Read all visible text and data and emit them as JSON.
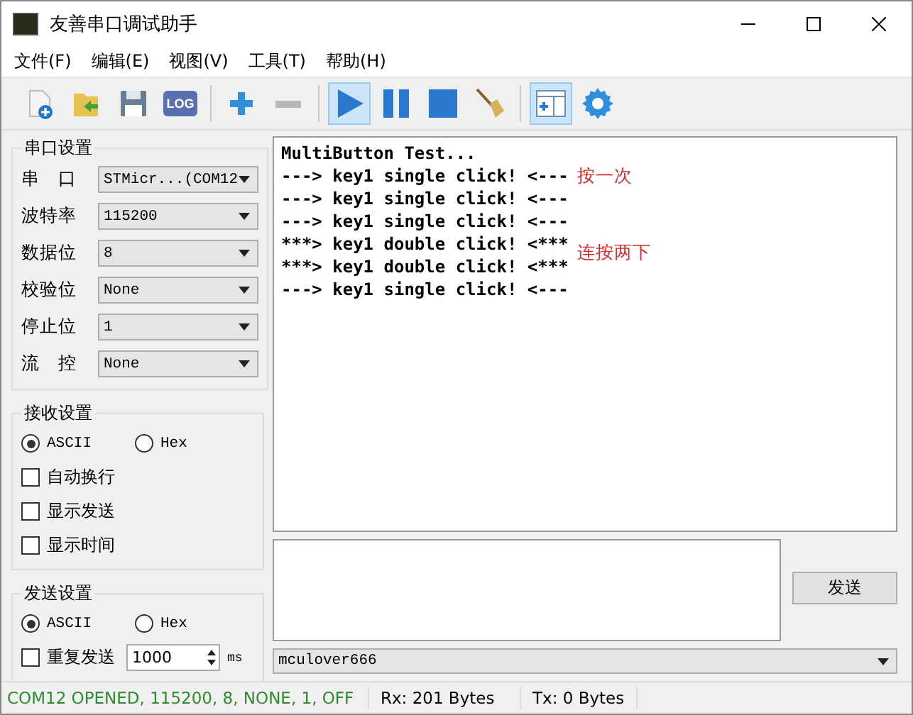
{
  "window": {
    "title": "友善串口调试助手"
  },
  "menu": [
    "文件(F)",
    "编辑(E)",
    "视图(V)",
    "工具(T)",
    "帮助(H)"
  ],
  "toolbar": [
    {
      "kind": "new",
      "selected": false
    },
    {
      "kind": "open",
      "selected": false
    },
    {
      "kind": "save",
      "selected": false
    },
    {
      "kind": "log",
      "label": "LOG",
      "selected": false
    },
    {
      "kind": "sep"
    },
    {
      "kind": "add",
      "selected": false
    },
    {
      "kind": "remove",
      "selected": false
    },
    {
      "kind": "sep"
    },
    {
      "kind": "play",
      "selected": true
    },
    {
      "kind": "pause",
      "selected": false
    },
    {
      "kind": "stop",
      "selected": false
    },
    {
      "kind": "clear",
      "selected": false
    },
    {
      "kind": "sep"
    },
    {
      "kind": "layout",
      "selected": true
    },
    {
      "kind": "settings",
      "selected": false
    }
  ],
  "port_settings": {
    "title": "串口设置",
    "fields": [
      {
        "label": "串　口",
        "value": "STMicr...(COM12"
      },
      {
        "label": "波特率",
        "value": "115200"
      },
      {
        "label": "数据位",
        "value": "8"
      },
      {
        "label": "校验位",
        "value": "None"
      },
      {
        "label": "停止位",
        "value": "1"
      },
      {
        "label": "流　控",
        "value": "None"
      }
    ]
  },
  "receive_settings": {
    "title": "接收设置",
    "modes": [
      {
        "label": "ASCII",
        "selected": true
      },
      {
        "label": "Hex",
        "selected": false
      }
    ],
    "options": [
      {
        "label": "自动换行",
        "checked": false
      },
      {
        "label": "显示发送",
        "checked": false
      },
      {
        "label": "显示时间",
        "checked": false
      }
    ]
  },
  "send_settings": {
    "title": "发送设置",
    "modes": [
      {
        "label": "ASCII",
        "selected": true
      },
      {
        "label": "Hex",
        "selected": false
      }
    ],
    "repeat": {
      "label": "重复发送",
      "checked": false
    },
    "interval": "1000",
    "unit": "ms"
  },
  "receive_lines": [
    {
      "text": "MultiButton Test..."
    },
    {
      "text": "---> key1 single click! <---",
      "note": "按一次"
    },
    {
      "text": "---> key1 single click! <---"
    },
    {
      "text": "---> key1 single click! <---"
    },
    {
      "text": "***> key1 double click! <***",
      "note": "连按两下"
    },
    {
      "text": "***> key1 double click! <***"
    },
    {
      "text": "---> key1 single click! <---"
    }
  ],
  "send_button": "发送",
  "history": "mculover666",
  "status_bar": [
    "COM12 OPENED, 115200, 8, NONE, 1, OFF",
    "Rx: 201 Bytes",
    "Tx: 0 Bytes"
  ]
}
